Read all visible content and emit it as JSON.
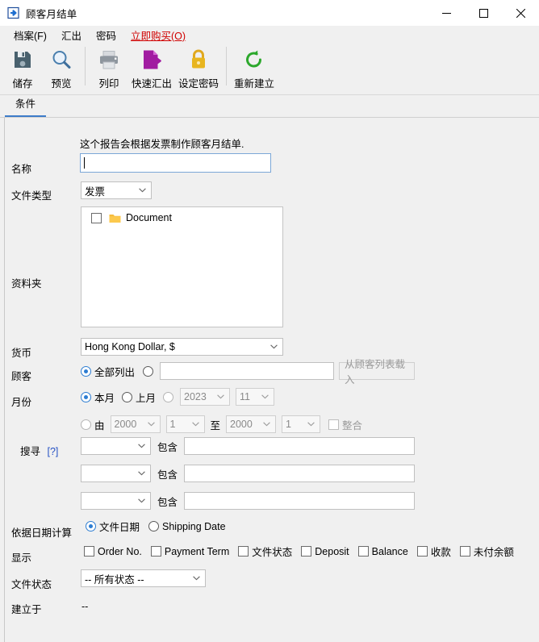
{
  "window": {
    "title": "顾客月结单",
    "icon": "export-arrow-icon",
    "controls": {
      "minimize": "—",
      "maximize": "□",
      "close": "✕"
    }
  },
  "menubar": {
    "items": [
      {
        "label": "档案(F)",
        "accent": false
      },
      {
        "label": "汇出",
        "accent": false
      },
      {
        "label": "密码",
        "accent": false
      },
      {
        "label": "立即购买(O)",
        "accent": true
      }
    ]
  },
  "toolbar": {
    "buttons": [
      {
        "label": "储存",
        "icon": "save-floppy-icon",
        "color": "#4b5a64"
      },
      {
        "label": "预览",
        "icon": "magnifier-icon",
        "color": "#5a7fa8"
      },
      {
        "label": "列印",
        "icon": "printer-icon",
        "color": "#8c9298"
      },
      {
        "label": "快速汇出",
        "icon": "quick-export-icon",
        "color": "#a020a0"
      },
      {
        "label": "设定密码",
        "icon": "lock-icon",
        "color": "#e0a81e"
      },
      {
        "label": "重新建立",
        "icon": "refresh-icon",
        "color": "#2da02d"
      }
    ]
  },
  "tabs": [
    {
      "label": "条件",
      "selected": true
    }
  ],
  "form": {
    "description": "这个报告会根据发票制作顾客月结单.",
    "name": {
      "label": "名称",
      "value": "",
      "focused": true
    },
    "file_type": {
      "label": "文件类型",
      "value": "发票"
    },
    "folder": {
      "label": "资料夹",
      "items": [
        {
          "label": "Document",
          "checked": false,
          "icon": "folder-icon"
        }
      ]
    },
    "currency": {
      "label": "货币",
      "value": "Hong Kong Dollar, $"
    },
    "customer": {
      "label": "顾客",
      "option_all": "全部列出",
      "option_all_selected": true,
      "option_custom_selected": false,
      "input_value": "",
      "load_button": "从顾客列表载入"
    },
    "month": {
      "label": "月份",
      "option_this": "本月",
      "option_this_selected": true,
      "option_last": "上月",
      "option_last_selected": false,
      "option_specific_selected": false,
      "year_value": "2023",
      "month_value": "11",
      "range_selected": false,
      "from_label": "由",
      "from_year": "2000",
      "from_month": "1",
      "to_label": "至",
      "to_year": "2000",
      "to_month": "1",
      "consolidate_label": "整合",
      "consolidate_checked": false
    },
    "search": {
      "label": "搜寻",
      "help": "[?]",
      "rows": [
        {
          "field": "",
          "operator": "包含",
          "value": ""
        },
        {
          "field": "",
          "operator": "包含",
          "value": ""
        },
        {
          "field": "",
          "operator": "包含",
          "value": ""
        }
      ]
    },
    "date_basis": {
      "label": "依据日期计算",
      "option_doc": "文件日期",
      "option_doc_selected": true,
      "option_ship": "Shipping Date",
      "option_ship_selected": false
    },
    "display": {
      "label": "显示",
      "options": [
        {
          "label": "Order No.",
          "checked": false
        },
        {
          "label": "Payment Term",
          "checked": false
        },
        {
          "label": "文件状态",
          "checked": false
        },
        {
          "label": "Deposit",
          "checked": false
        },
        {
          "label": "Balance",
          "checked": false
        },
        {
          "label": "收款",
          "checked": false
        },
        {
          "label": "未付余额",
          "checked": false
        }
      ]
    },
    "doc_status": {
      "label": "文件状态",
      "value": "-- 所有状态 --"
    },
    "created_at": {
      "label": "建立于",
      "value": "--"
    }
  }
}
